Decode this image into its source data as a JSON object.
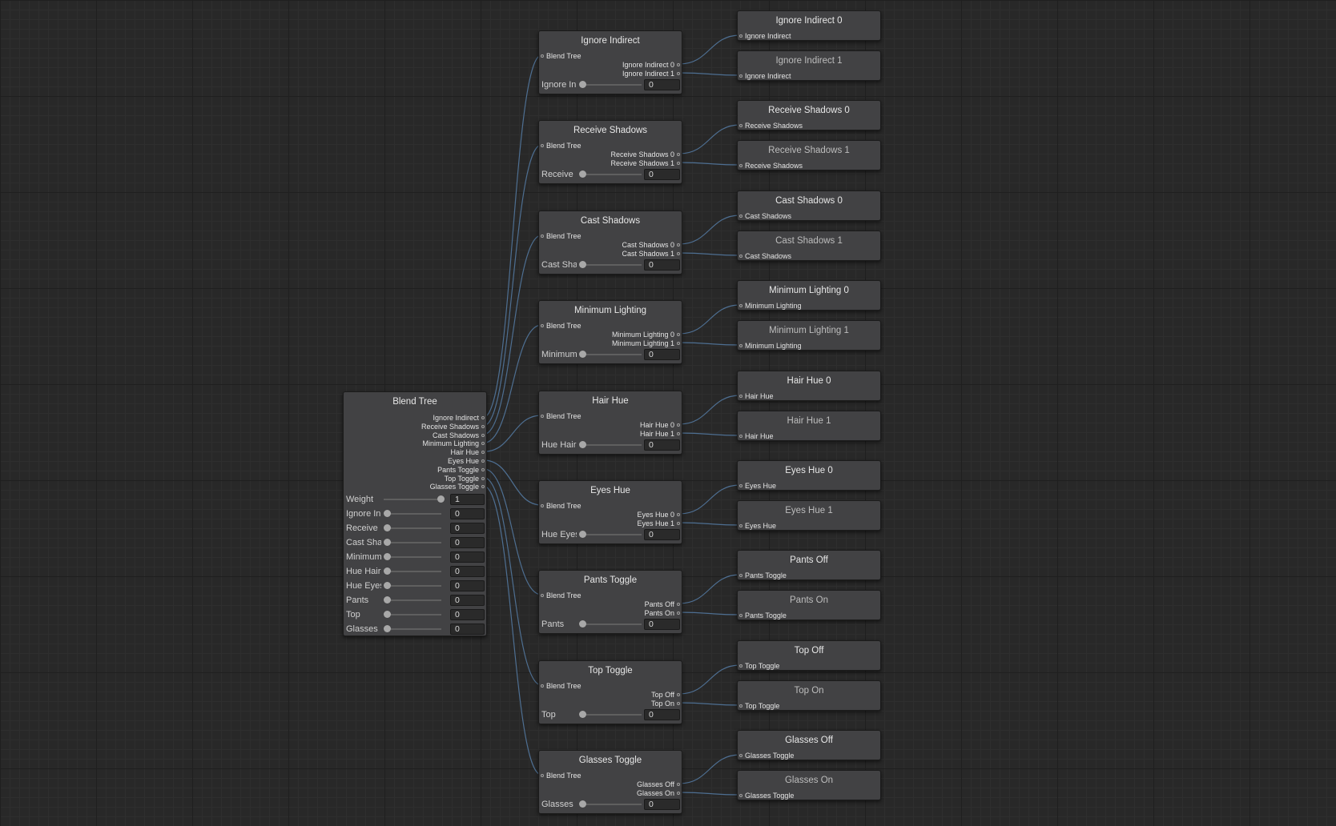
{
  "root": {
    "title": "Blend Tree",
    "outputs": [
      "Ignore Indirect",
      "Receive Shadows",
      "Cast Shadows",
      "Minimum Lighting",
      "Hair Hue",
      "Eyes Hue",
      "Pants Toggle",
      "Top Toggle",
      "Glasses Toggle"
    ],
    "params": [
      {
        "label": "Weight",
        "value": "1",
        "level": 1
      },
      {
        "label": "Ignore In",
        "value": "0",
        "level": 0
      },
      {
        "label": "Receive",
        "value": "0",
        "level": 0
      },
      {
        "label": "Cast Sha",
        "value": "0",
        "level": 0
      },
      {
        "label": "Minimum",
        "value": "0",
        "level": 0
      },
      {
        "label": "Hue Hair",
        "value": "0",
        "level": 0
      },
      {
        "label": "Hue Eyes",
        "value": "0",
        "level": 0
      },
      {
        "label": "Pants",
        "value": "0",
        "level": 0
      },
      {
        "label": "Top",
        "value": "0",
        "level": 0
      },
      {
        "label": "Glasses",
        "value": "0",
        "level": 0
      }
    ]
  },
  "groups": [
    {
      "title": "Ignore Indirect",
      "input": "Blend Tree",
      "outputs": [
        "Ignore Indirect 0",
        "Ignore Indirect 1"
      ],
      "param": {
        "label": "Ignore In",
        "value": "0",
        "level": 0
      },
      "leaves": [
        {
          "title": "Ignore Indirect 0",
          "input": "Ignore Indirect"
        },
        {
          "title": "Ignore Indirect 1",
          "input": "Ignore Indirect"
        }
      ]
    },
    {
      "title": "Receive Shadows",
      "input": "Blend Tree",
      "outputs": [
        "Receive Shadows 0",
        "Receive Shadows 1"
      ],
      "param": {
        "label": "Receive",
        "value": "0",
        "level": 0
      },
      "leaves": [
        {
          "title": "Receive Shadows 0",
          "input": "Receive Shadows"
        },
        {
          "title": "Receive Shadows 1",
          "input": "Receive Shadows"
        }
      ]
    },
    {
      "title": "Cast Shadows",
      "input": "Blend Tree",
      "outputs": [
        "Cast Shadows 0",
        "Cast Shadows 1"
      ],
      "param": {
        "label": "Cast Sha",
        "value": "0",
        "level": 0
      },
      "leaves": [
        {
          "title": "Cast Shadows 0",
          "input": "Cast Shadows"
        },
        {
          "title": "Cast Shadows 1",
          "input": "Cast Shadows"
        }
      ]
    },
    {
      "title": "Minimum Lighting",
      "input": "Blend Tree",
      "outputs": [
        "Minimum Lighting 0",
        "Minimum Lighting 1"
      ],
      "param": {
        "label": "Minimum",
        "value": "0",
        "level": 0
      },
      "leaves": [
        {
          "title": "Minimum Lighting 0",
          "input": "Minimum Lighting"
        },
        {
          "title": "Minimum Lighting 1",
          "input": "Minimum Lighting"
        }
      ]
    },
    {
      "title": "Hair Hue",
      "input": "Blend Tree",
      "outputs": [
        "Hair Hue 0",
        "Hair Hue 1"
      ],
      "param": {
        "label": "Hue Hair",
        "value": "0",
        "level": 0
      },
      "leaves": [
        {
          "title": "Hair Hue 0",
          "input": "Hair Hue"
        },
        {
          "title": "Hair Hue 1",
          "input": "Hair Hue"
        }
      ]
    },
    {
      "title": "Eyes Hue",
      "input": "Blend Tree",
      "outputs": [
        "Eyes Hue 0",
        "Eyes Hue 1"
      ],
      "param": {
        "label": "Hue Eyes",
        "value": "0",
        "level": 0
      },
      "leaves": [
        {
          "title": "Eyes Hue 0",
          "input": "Eyes Hue"
        },
        {
          "title": "Eyes Hue 1",
          "input": "Eyes Hue"
        }
      ]
    },
    {
      "title": "Pants Toggle",
      "input": "Blend Tree",
      "outputs": [
        "Pants Off",
        "Pants On"
      ],
      "param": {
        "label": "Pants",
        "value": "0",
        "level": 0
      },
      "leaves": [
        {
          "title": "Pants Off",
          "input": "Pants Toggle"
        },
        {
          "title": "Pants On",
          "input": "Pants Toggle"
        }
      ]
    },
    {
      "title": "Top Toggle",
      "input": "Blend Tree",
      "outputs": [
        "Top Off",
        "Top On"
      ],
      "param": {
        "label": "Top",
        "value": "0",
        "level": 0
      },
      "leaves": [
        {
          "title": "Top Off",
          "input": "Top Toggle"
        },
        {
          "title": "Top On",
          "input": "Top Toggle"
        }
      ]
    },
    {
      "title": "Glasses Toggle",
      "input": "Blend Tree",
      "outputs": [
        "Glasses Off",
        "Glasses On"
      ],
      "param": {
        "label": "Glasses",
        "value": "0",
        "level": 0
      },
      "leaves": [
        {
          "title": "Glasses Off",
          "input": "Glasses Toggle"
        },
        {
          "title": "Glasses On",
          "input": "Glasses Toggle"
        }
      ]
    }
  ],
  "colors": {
    "wire": "#4e6f92",
    "node": "#424244",
    "canvas": "#282828"
  }
}
